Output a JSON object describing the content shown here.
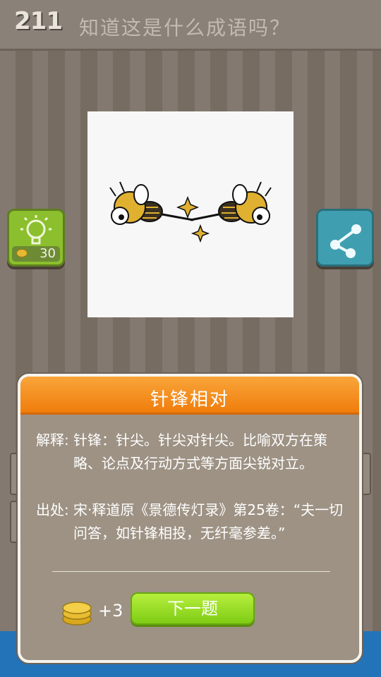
{
  "header": {
    "level": "211",
    "question": "知道这是什么成语吗？"
  },
  "hint": {
    "cost": "30",
    "icon": "lightbulb-icon"
  },
  "share": {
    "icon": "share-icon"
  },
  "dialog": {
    "title": "针锋相对",
    "explanation_label": "解释:",
    "explanation_text": "针锋：针尖。针尖对针尖。比喻双方在策略、论点及行动方式等方面尖锐对立。",
    "source_label": "出处:",
    "source_text": "宋·释道原《景德传灯录》第25卷：“夫一切问答，如针锋相投，无纤毫参差。”",
    "reward": "+3",
    "next_button": "下一题"
  },
  "colors": {
    "accent_orange": "#f07d0c",
    "hint_green": "#8cbf2d",
    "share_blue": "#3f9fb0",
    "next_green": "#7fcc14"
  }
}
